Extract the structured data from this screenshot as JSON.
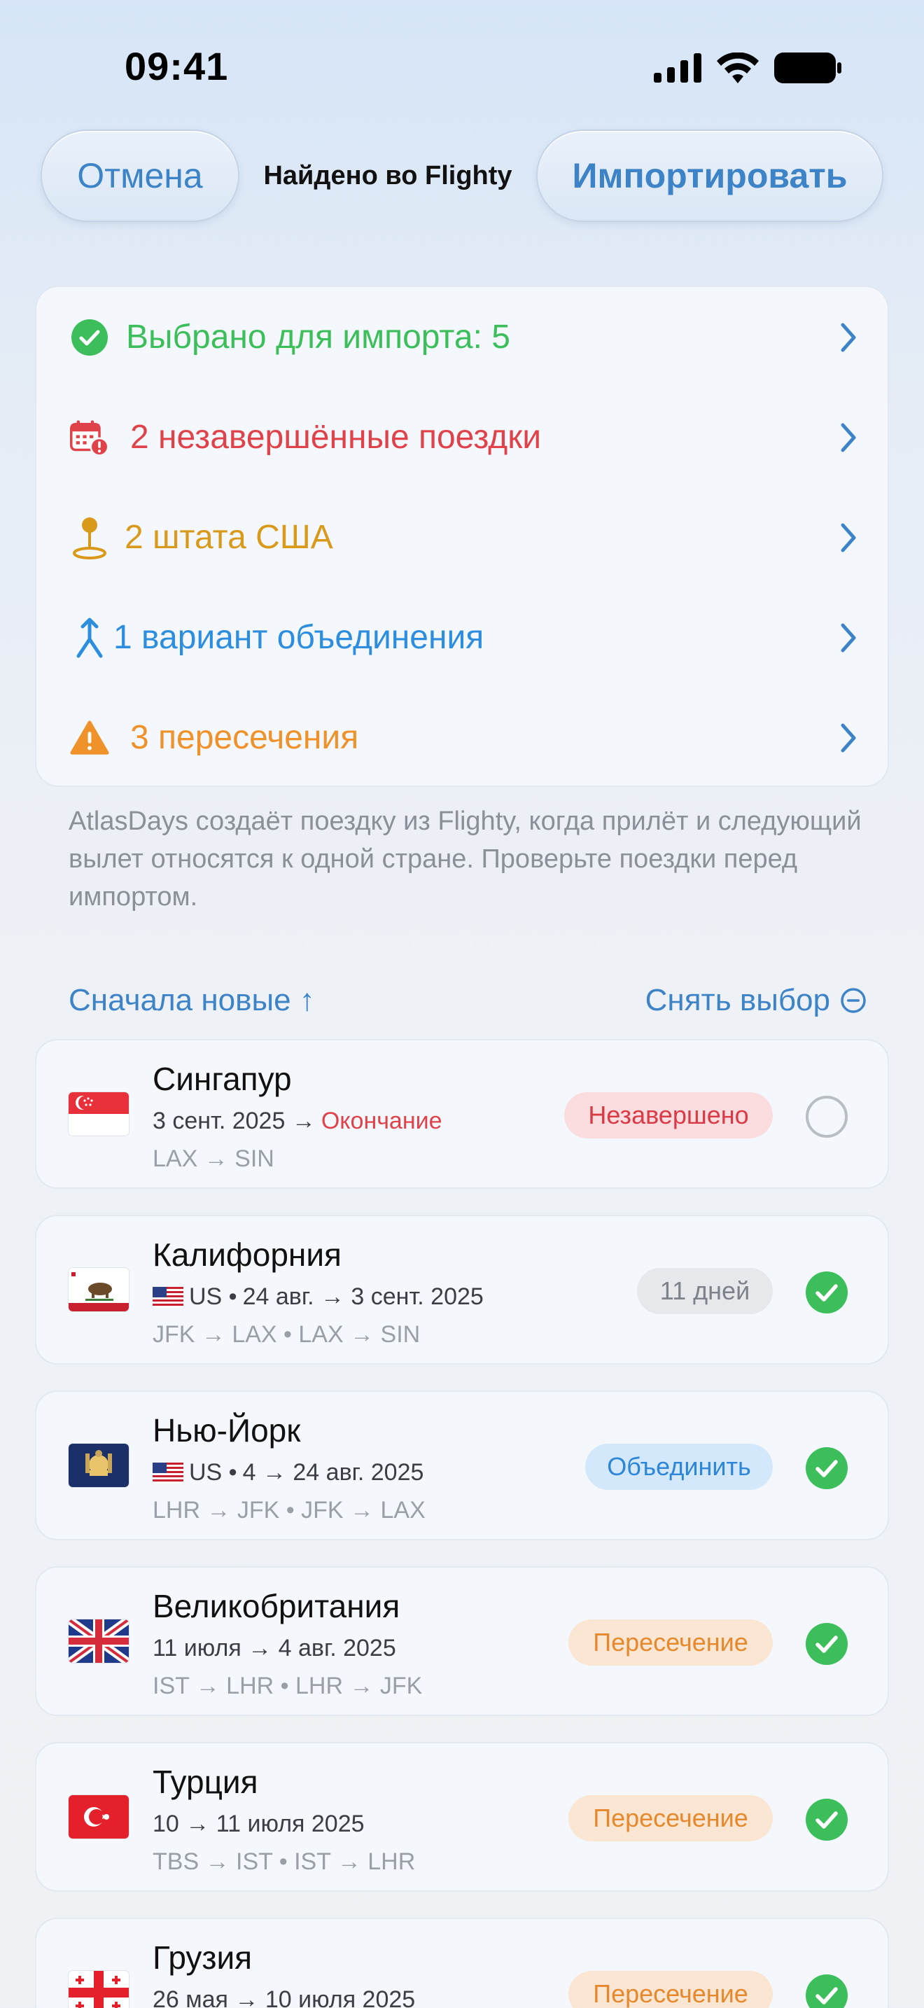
{
  "status_bar": {
    "time": "09:41"
  },
  "nav": {
    "cancel": "Отмена",
    "title": "Найдено во Flighty",
    "import": "Импортировать"
  },
  "summary": [
    {
      "label": "Выбрано для импорта: 5",
      "color": "#3cbf5b",
      "icon": "checkmark-circle-icon"
    },
    {
      "label": "2 незавершённые поездки",
      "color": "#e0424a",
      "icon": "calendar-alert-icon"
    },
    {
      "label": "2 штата США",
      "color": "#d99a1c",
      "icon": "map-pin-icon"
    },
    {
      "label": "1 вариант объединения",
      "color": "#2d8ee0",
      "icon": "merge-icon"
    },
    {
      "label": "3 пересечения",
      "color": "#f0922a",
      "icon": "warning-triangle-icon"
    }
  ],
  "note": "AtlasDays создаёт поездку из Flighty, когда прилёт и следующий вылет относятся к одной стране. Проверьте поездки перед импортом.",
  "sort": {
    "label": "Сначала новые ↑"
  },
  "deselect": {
    "label": "Снять выбор"
  },
  "trips": [
    {
      "name": "Сингапур",
      "dates": "3 сент. 2025 →",
      "dates_extra": "Окончание",
      "route": "LAX → SIN",
      "badge": "Незавершено",
      "badge_bg": "#fbdde0",
      "badge_color": "#d93a45",
      "selected": false,
      "flag": "singapore"
    },
    {
      "name": "Калифорния",
      "country": "US •",
      "dates": "24 авг. → 3 сент. 2025",
      "route": "JFK → LAX • LAX → SIN",
      "badge": "11 дней",
      "badge_bg": "#e6e8ec",
      "badge_color": "#7d828a",
      "selected": true,
      "flag": "california"
    },
    {
      "name": "Нью-Йорк",
      "country": "US •",
      "dates": "4 → 24 авг. 2025",
      "route": "LHR → JFK • JFK → LAX",
      "badge": "Объединить",
      "badge_bg": "#d4e8fb",
      "badge_color": "#2d86d8",
      "selected": true,
      "flag": "new-york"
    },
    {
      "name": "Великобритания",
      "dates": "11 июля → 4 авг. 2025",
      "route": "IST → LHR • LHR → JFK",
      "badge": "Пересечение",
      "badge_bg": "#fae6d3",
      "badge_color": "#e6892c",
      "selected": true,
      "flag": "uk"
    },
    {
      "name": "Турция",
      "dates": "10 → 11 июля 2025",
      "route": "TBS → IST • IST → LHR",
      "badge": "Пересечение",
      "badge_bg": "#fae6d3",
      "badge_color": "#e6892c",
      "selected": true,
      "flag": "turkey"
    },
    {
      "name": "Грузия",
      "dates": "26 мая → 10 июля 2025",
      "route": "",
      "badge": "Пересечение",
      "badge_bg": "#fae6d3",
      "badge_color": "#e6892c",
      "selected": true,
      "flag": "georgia"
    }
  ]
}
